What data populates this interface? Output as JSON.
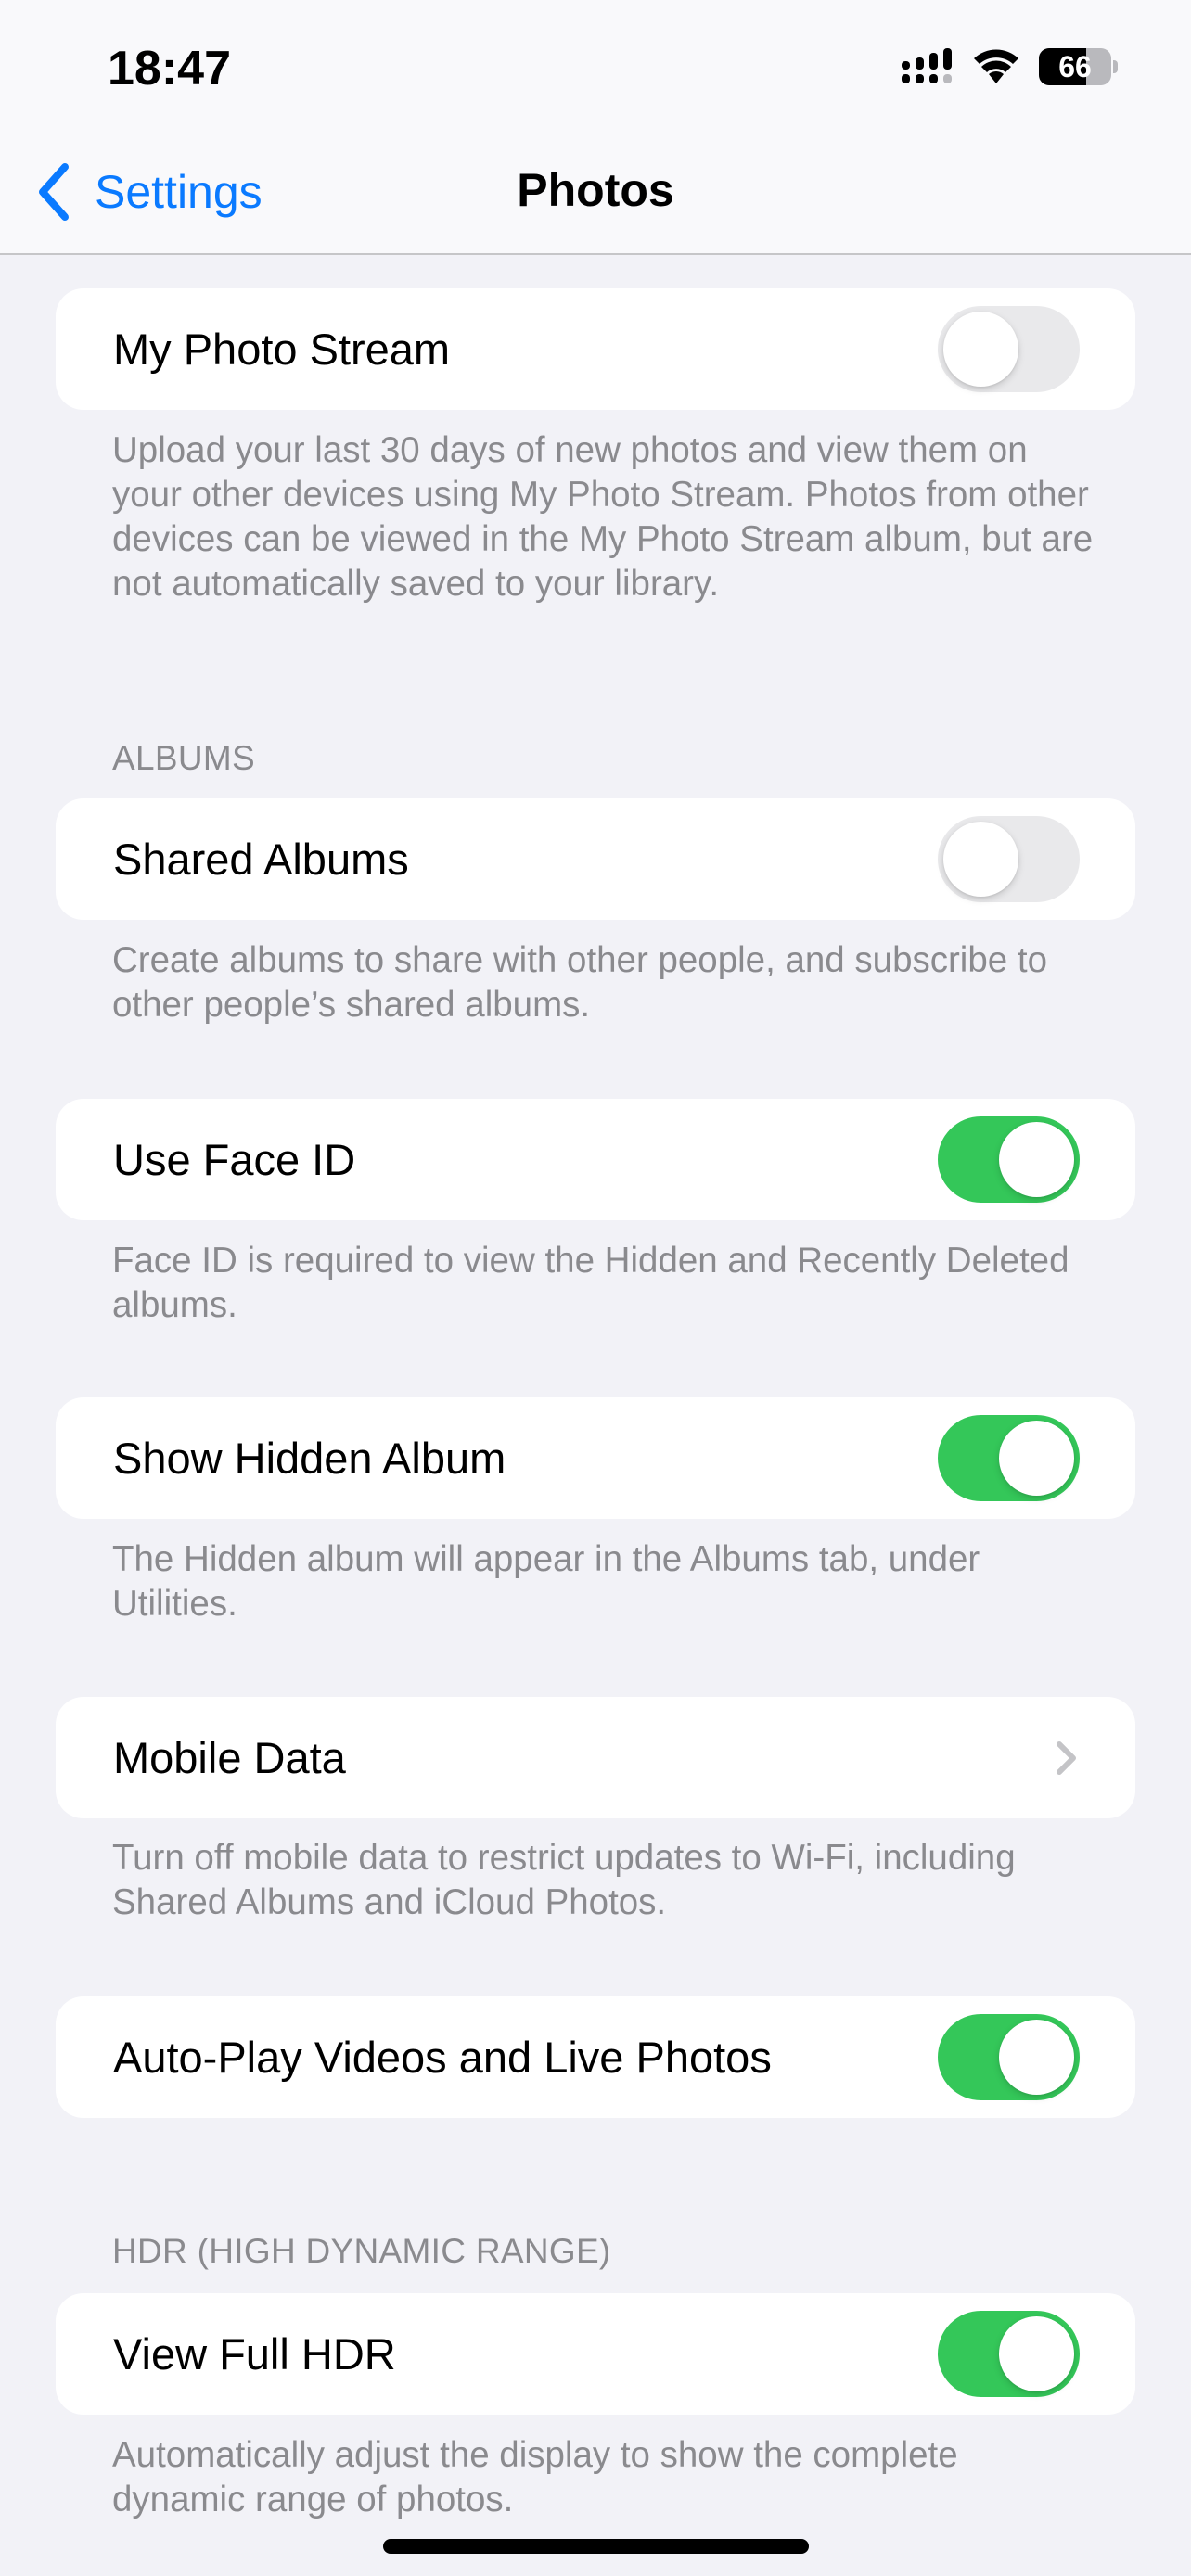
{
  "status_bar": {
    "time": "18:47",
    "battery_level": 66,
    "battery_text": "66",
    "icons": [
      "signal-icon",
      "wifi-icon",
      "battery-icon"
    ]
  },
  "nav": {
    "back_label": "Settings",
    "back_icon": "chevron-left-icon",
    "title": "Photos"
  },
  "colors": {
    "accent": "#0a7aff",
    "toggle_on": "#34c759",
    "toggle_off": "#e9e9eb",
    "background": "#f2f2f7",
    "secondary_text": "#8a8a8e"
  },
  "sections": [
    {
      "header": "",
      "rows": [
        {
          "label": "My Photo Stream",
          "type": "toggle",
          "on": false
        }
      ],
      "footer": "Upload your last 30 days of new photos and view them on your other devices using My Photo Stream. Photos from other devices can be viewed in the My Photo Stream album, but are not automatically saved to your library."
    },
    {
      "header": "ALBUMS",
      "rows": [
        {
          "label": "Shared Albums",
          "type": "toggle",
          "on": false
        }
      ],
      "footer": "Create albums to share with other people, and subscribe to other people’s shared albums."
    },
    {
      "header": "",
      "rows": [
        {
          "label": "Use Face ID",
          "type": "toggle",
          "on": true
        }
      ],
      "footer": "Face ID is required to view the Hidden and Recently Deleted albums."
    },
    {
      "header": "",
      "rows": [
        {
          "label": "Show Hidden Album",
          "type": "toggle",
          "on": true
        }
      ],
      "footer": "The Hidden album will appear in the Albums tab, under Utilities."
    },
    {
      "header": "",
      "rows": [
        {
          "label": "Mobile Data",
          "type": "disclosure",
          "icon": "chevron-right-icon"
        }
      ],
      "footer": "Turn off mobile data to restrict updates to Wi-Fi, including Shared Albums and iCloud Photos."
    },
    {
      "header": "",
      "rows": [
        {
          "label": "Auto-Play Videos and Live Photos",
          "type": "toggle",
          "on": true
        }
      ],
      "footer": ""
    },
    {
      "header": "HDR (HIGH DYNAMIC RANGE)",
      "rows": [
        {
          "label": "View Full HDR",
          "type": "toggle",
          "on": true
        }
      ],
      "footer": "Automatically adjust the display to show the complete dynamic range of photos."
    }
  ]
}
